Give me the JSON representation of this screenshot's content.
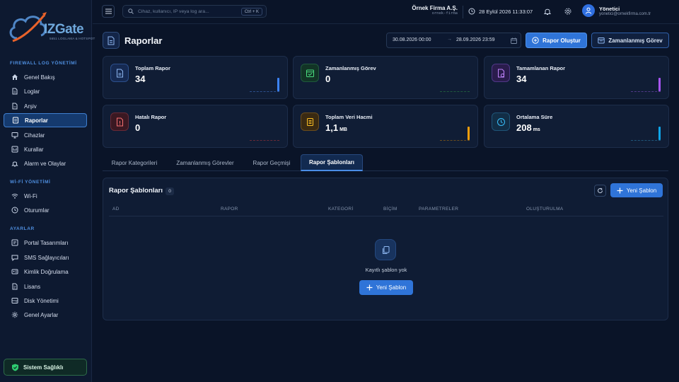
{
  "brand": {
    "name": "IZGate",
    "tagline": "5651 LOGLAMA & HOTSPOT"
  },
  "sidebar": {
    "sections": [
      {
        "title": "FIREWALL LOG YÖNETİMİ"
      },
      {
        "title": "Wİ-Fİ YÖNETİMİ"
      },
      {
        "title": "AYARLAR"
      }
    ],
    "items": [
      {
        "label": "Genel Bakış",
        "icon": "home-icon"
      },
      {
        "label": "Loglar",
        "icon": "document-icon"
      },
      {
        "label": "Arşiv",
        "icon": "archive-icon"
      },
      {
        "label": "Raporlar",
        "icon": "report-icon",
        "active": true
      },
      {
        "label": "Cihazlar",
        "icon": "monitor-icon"
      },
      {
        "label": "Kurallar",
        "icon": "rules-icon"
      },
      {
        "label": "Alarm ve Olaylar",
        "icon": "bell-icon"
      },
      {
        "label": "Wi-Fi",
        "icon": "wifi-icon"
      },
      {
        "label": "Oturumlar",
        "icon": "clock-icon"
      },
      {
        "label": "Portal Tasarımları",
        "icon": "portal-icon"
      },
      {
        "label": "SMS Sağlayıcıları",
        "icon": "sms-icon"
      },
      {
        "label": "Kimlik Doğrulama",
        "icon": "id-card-icon"
      },
      {
        "label": "Lisans",
        "icon": "license-icon"
      },
      {
        "label": "Disk Yönetimi",
        "icon": "disk-icon"
      },
      {
        "label": "Genel Ayarlar",
        "icon": "gear-icon"
      }
    ],
    "health_label": "Sistem Sağlıklı"
  },
  "topbar": {
    "search_placeholder": "Cihaz, kullanıcı, IP veya log ara...",
    "search_shortcut": "Ctrl + K",
    "company_name": "Örnek Firma A.Ş.",
    "company_slug": "ornek-firma",
    "datetime": "28 Eylül 2026 11:33:07",
    "user_name": "Yönetici",
    "user_email": "yonetici@ornekfirma.com.tr"
  },
  "page": {
    "title": "Raporlar",
    "date_from": "30.08.2026 00:00",
    "date_arrow": "→",
    "date_to": "28.09.2026 23:59",
    "create_report_label": "Rapor Oluştur",
    "scheduled_task_label": "Zamanlanmış Görev"
  },
  "stats": [
    {
      "label": "Toplam Rapor",
      "value": "34",
      "unit": "",
      "color": "#3b82f6"
    },
    {
      "label": "Zamanlanmış Görev",
      "value": "0",
      "unit": "",
      "color": "#22c55e"
    },
    {
      "label": "Tamamlanan Rapor",
      "value": "34",
      "unit": "",
      "color": "#a855f7"
    },
    {
      "label": "Hatalı Rapor",
      "value": "0",
      "unit": "",
      "color": "#ef4444"
    },
    {
      "label": "Toplam Veri Hacmi",
      "value": "1,1",
      "unit": "MB",
      "color": "#f59e0b"
    },
    {
      "label": "Ortalama Süre",
      "value": "208",
      "unit": "ms",
      "color": "#0ea5e9"
    }
  ],
  "tabs": [
    {
      "label": "Rapor Kategorileri"
    },
    {
      "label": "Zamanlanmış Görevler"
    },
    {
      "label": "Rapor Geçmişi"
    },
    {
      "label": "Rapor Şablonları",
      "active": true
    }
  ],
  "templates": {
    "title": "Rapor Şablonları",
    "count": "0",
    "new_label": "Yeni Şablon",
    "columns": [
      "AD",
      "RAPOR",
      "KATEGORİ",
      "BİÇİM",
      "PARAMETRELER",
      "OLUŞTURULMA"
    ],
    "empty_text": "Kayıtlı şablon yok",
    "empty_button": "Yeni Şablon"
  }
}
